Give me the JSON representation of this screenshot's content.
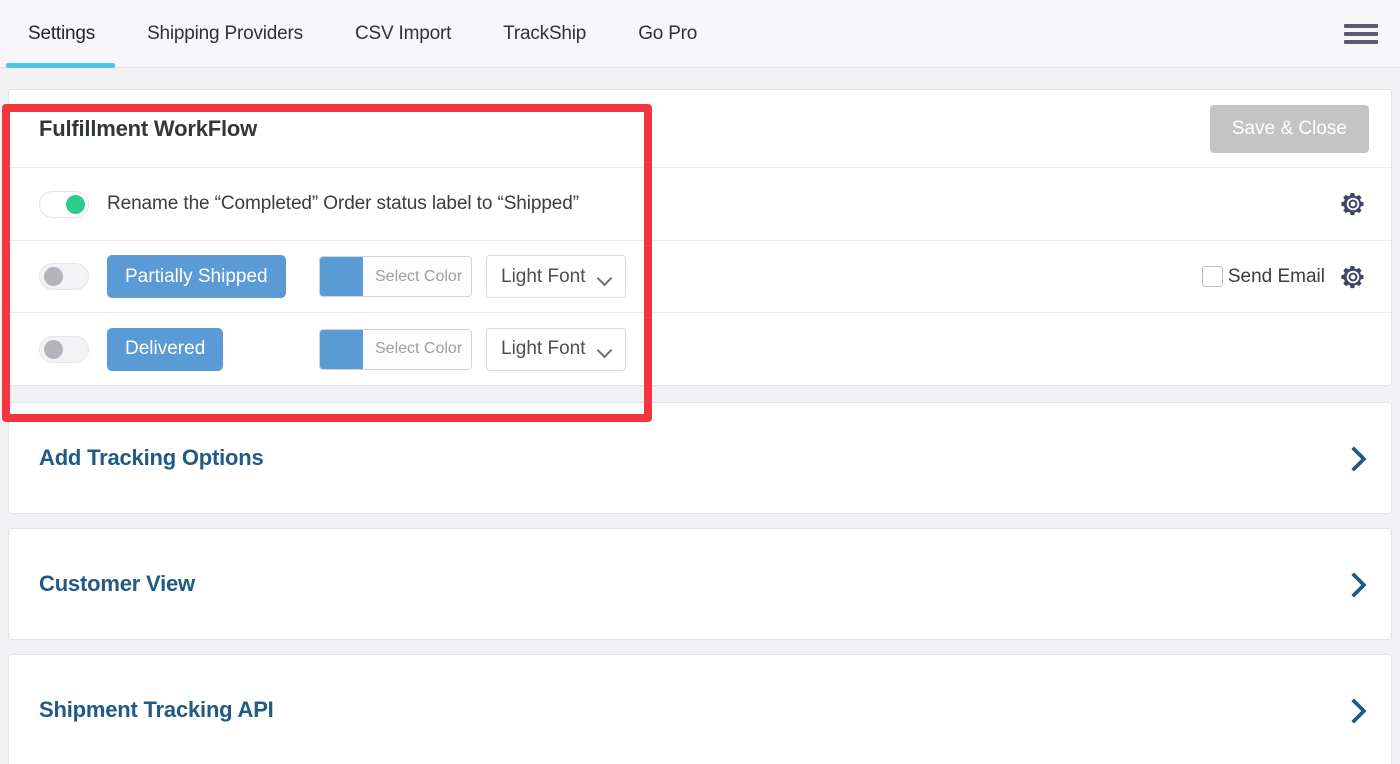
{
  "header": {
    "tabs": [
      {
        "label": "Settings",
        "active": true
      },
      {
        "label": "Shipping Providers",
        "active": false
      },
      {
        "label": "CSV Import",
        "active": false
      },
      {
        "label": "TrackShip",
        "active": false
      },
      {
        "label": "Go Pro",
        "active": false
      }
    ],
    "menu_icon": "hamburger-icon",
    "active_tab_color": "#4cc6e4"
  },
  "workflow": {
    "title": "Fulfillment WorkFlow",
    "save_button": "Save & Close",
    "save_button_color": "#c4c4c4",
    "rows": [
      {
        "toggle_state": "on",
        "toggle_color": "#2bcc8c",
        "label": "Rename the “Completed” Order status label to “Shipped”",
        "has_settings_gear": true,
        "has_send_email": false
      },
      {
        "toggle_state": "off",
        "status_label": "Partially Shipped",
        "status_color": "#5b9bd5",
        "color_placeholder": "Select Color",
        "swatch_color": "#5b9bd5",
        "font_option": "Light Font",
        "send_email_label": "Send Email",
        "send_email_checked": false,
        "has_settings_gear": true,
        "has_send_email": true
      },
      {
        "toggle_state": "off",
        "status_label": "Delivered",
        "status_color": "#5b9bd5",
        "color_placeholder": "Select Color",
        "swatch_color": "#5b9bd5",
        "font_option": "Light Font",
        "has_settings_gear": false,
        "has_send_email": false
      }
    ]
  },
  "sections": [
    {
      "title": "Add Tracking Options",
      "expand_icon": "chevron-right-icon"
    },
    {
      "title": "Customer View",
      "expand_icon": "chevron-right-icon"
    },
    {
      "title": "Shipment Tracking API",
      "expand_icon": "chevron-right-icon"
    }
  ],
  "highlight": {
    "color": "#f4343f",
    "target": "fulfillment-workflow-panel"
  }
}
